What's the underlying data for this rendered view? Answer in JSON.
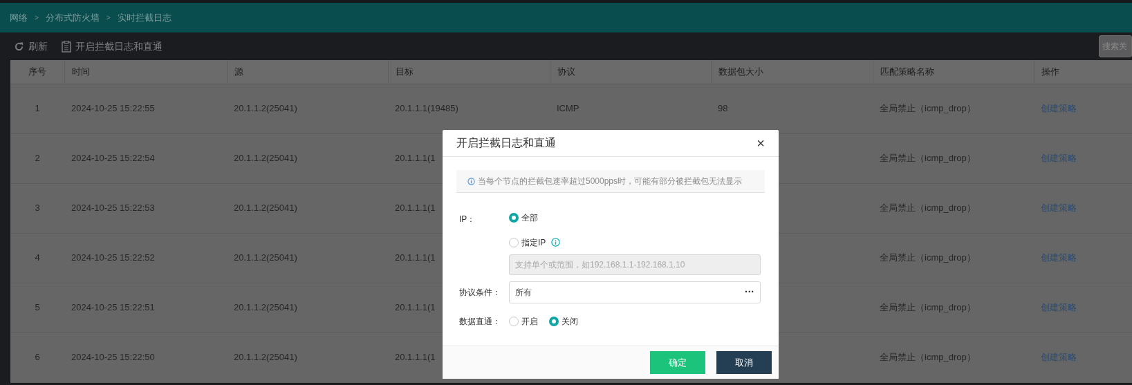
{
  "breadcrumb": [
    {
      "label": "网络"
    },
    {
      "label": "分布式防火墙"
    },
    {
      "label": "实时拦截日志"
    }
  ],
  "breadcrumb_separator": ">",
  "toolbar": [
    {
      "kind": "refresh",
      "label": "刷新"
    },
    {
      "kind": "log",
      "label": "开启拦截日志和直通"
    }
  ],
  "search": {
    "placeholder": "搜索关"
  },
  "table": {
    "columns": [
      "序号",
      "时间",
      "源",
      "目标",
      "协议",
      "数据包大小",
      "匹配策略名称",
      "操作"
    ],
    "rows": [
      {
        "no": "1",
        "time": "2024-10-25 15:22:55",
        "source": "20.1.1.2(25041)",
        "target": "20.1.1.1(19485)",
        "protocol": "ICMP",
        "size": "98",
        "policy": "全局禁止（icmp_drop）",
        "action": "创建策略"
      },
      {
        "no": "2",
        "time": "2024-10-25 15:22:54",
        "source": "20.1.1.2(25041)",
        "target": "20.1.1.1(1",
        "policy": "全局禁止（icmp_drop）",
        "action": "创建策略"
      },
      {
        "no": "3",
        "time": "2024-10-25 15:22:53",
        "source": "20.1.1.2(25041)",
        "target": "20.1.1.1(1",
        "policy": "全局禁止（icmp_drop）",
        "action": "创建策略"
      },
      {
        "no": "4",
        "time": "2024-10-25 15:22:52",
        "source": "20.1.1.2(25041)",
        "target": "20.1.1.1(1",
        "policy": "全局禁止（icmp_drop）",
        "action": "创建策略"
      },
      {
        "no": "5",
        "time": "2024-10-25 15:22:51",
        "source": "20.1.1.2(25041)",
        "target": "20.1.1.1(1",
        "policy": "全局禁止（icmp_drop）",
        "action": "创建策略"
      },
      {
        "no": "6",
        "time": "2024-10-25 15:22:50",
        "source": "20.1.1.2(25041)",
        "target": "20.1.1.1(1",
        "policy": "全局禁止（icmp_drop）",
        "action": "创建策略"
      }
    ]
  },
  "modal": {
    "title": "开启拦截日志和直通",
    "close": "×",
    "notice": "当每个节点的拦截包速率超过5000pps时，可能有部分被拦截包无法显示",
    "ip_label": "IP：",
    "ip_options": [
      {
        "label": "全部",
        "selected": true
      },
      {
        "label": "指定IP",
        "selected": false
      }
    ],
    "ip_field": {
      "placeholder": "支持单个或范围，如192.168.1.1-192.168.1.10",
      "disabled": true
    },
    "protocol_label": "协议条件：",
    "protocol_value": "所有",
    "protocol_more": "···",
    "passthrough_label": "数据直通：",
    "passthrough_options": [
      {
        "label": "开启",
        "selected": false
      },
      {
        "label": "关闭",
        "selected": true
      }
    ],
    "buttons": [
      {
        "kind": "primary",
        "label": "确定"
      },
      {
        "kind": "secondary",
        "label": "取消"
      }
    ]
  }
}
